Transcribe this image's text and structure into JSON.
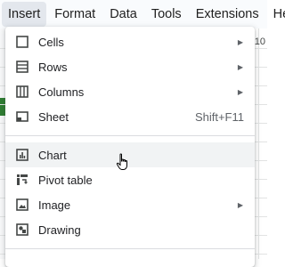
{
  "menubar": {
    "items": [
      {
        "label": "Insert"
      },
      {
        "label": "Format"
      },
      {
        "label": "Data"
      },
      {
        "label": "Tools"
      },
      {
        "label": "Extensions"
      },
      {
        "label": "Help"
      }
    ]
  },
  "sheet": {
    "right_hint": "10"
  },
  "menu": {
    "items": [
      {
        "label": "Cells",
        "icon": "cells-icon",
        "has_submenu": true
      },
      {
        "label": "Rows",
        "icon": "rows-icon",
        "has_submenu": true
      },
      {
        "label": "Columns",
        "icon": "columns-icon",
        "has_submenu": true
      },
      {
        "label": "Sheet",
        "icon": "sheet-icon",
        "shortcut": "Shift+F11"
      },
      {
        "label": "Chart",
        "icon": "chart-icon",
        "hovered": true
      },
      {
        "label": "Pivot table",
        "icon": "pivot-table-icon"
      },
      {
        "label": "Image",
        "icon": "image-icon",
        "has_submenu": true
      },
      {
        "label": "Drawing",
        "icon": "drawing-icon"
      }
    ]
  },
  "colors": {
    "menubar_bg": "#f9fbfd",
    "active_menubar_item_bg": "#e3e7ed",
    "menu_hover_bg": "#f1f3f4",
    "icon_color": "#444746"
  }
}
